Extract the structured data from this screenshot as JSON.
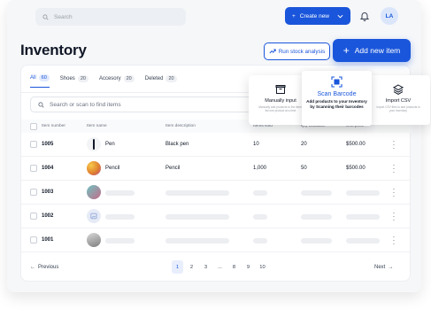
{
  "header": {
    "search_placeholder": "Search",
    "create_label": "Create new",
    "avatar_initials": "LA"
  },
  "page": {
    "title": "Inventory",
    "run_analysis_label": "Run stock analysis",
    "add_item_label": "Add new item"
  },
  "tabs": [
    {
      "label": "All",
      "count": "60"
    },
    {
      "label": "Shoes",
      "count": "20"
    },
    {
      "label": "Accesory",
      "count": "20"
    },
    {
      "label": "Deleted",
      "count": "20"
    }
  ],
  "find": {
    "placeholder": "Search or scan to find items"
  },
  "table": {
    "headers": [
      "Item number",
      "Item name",
      "Item description",
      "Items sold",
      "Qty available",
      "Unit price"
    ],
    "rows": [
      {
        "number": "1005",
        "name": "Pen",
        "description": "Black pen",
        "sold": "10",
        "qty": "20",
        "price": "$500.00",
        "loaded": true
      },
      {
        "number": "1004",
        "name": "Pencil",
        "description": "Pencil",
        "sold": "1,000",
        "qty": "50",
        "price": "$500.00",
        "loaded": true
      },
      {
        "number": "1003",
        "loaded": false
      },
      {
        "number": "1002",
        "loaded": false
      },
      {
        "number": "1001",
        "loaded": false
      }
    ]
  },
  "pagination": {
    "previous": "Previous",
    "next": "Next",
    "pages": [
      "1",
      "2",
      "3",
      "...",
      "8",
      "9",
      "10"
    ],
    "current": "1"
  },
  "add_options": [
    {
      "title": "Manually input",
      "description": "Manually add products to the items list one product at a time"
    },
    {
      "title": "Scan Barcode",
      "description": "Add products to your Inventory by Scanning their barcodes"
    },
    {
      "title": "Import CSV",
      "description": "Import CSV files to add products to your inventory"
    }
  ],
  "colors": {
    "accent": "#1a56db"
  }
}
